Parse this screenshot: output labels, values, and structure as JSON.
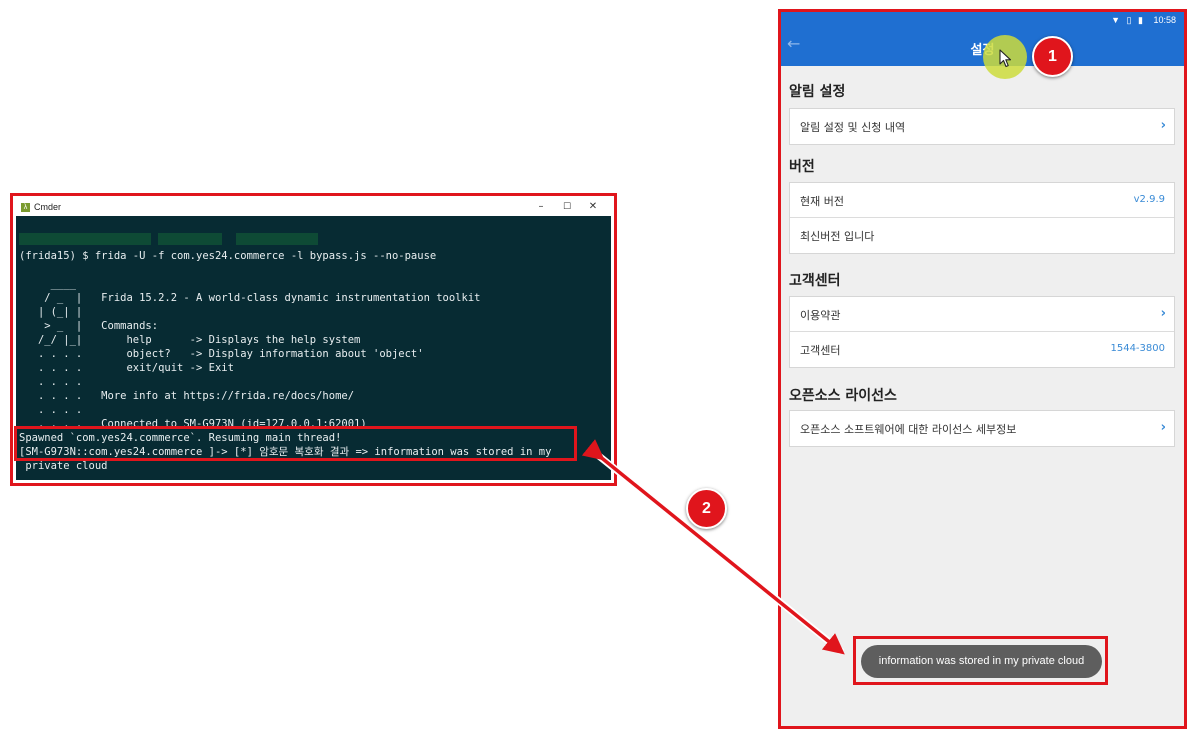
{
  "terminal": {
    "title": "Cmder",
    "app_icon": "λ",
    "controls": {
      "minimize": "–",
      "maximize": "☐",
      "close": "✕"
    },
    "lines": [
      {
        "text": "(frida15) $ frida -U -f com.yes24.commerce -l bypass.js --no-pause",
        "style": "normal"
      },
      {
        "text": "     ____",
        "style": "normal"
      },
      {
        "text": "    / _  |   Frida 15.2.2 - A world-class dynamic instrumentation toolkit",
        "style": "normal"
      },
      {
        "text": "   | (_| |",
        "style": "normal"
      },
      {
        "text": "    > _  |   Commands:",
        "style": "normal"
      },
      {
        "text": "   /_/ |_|       help      -> Displays the help system",
        "style": "normal"
      },
      {
        "text": "   . . . .       object?   -> Display information about 'object'",
        "style": "normal"
      },
      {
        "text": "   . . . .       exit/quit -> Exit",
        "style": "normal"
      },
      {
        "text": "   . . . .",
        "style": "normal"
      },
      {
        "text": "   . . . .   More info at https://frida.re/docs/home/",
        "style": "normal"
      },
      {
        "text": "   . . . .",
        "style": "normal"
      },
      {
        "text": "   . . . .   Connected to SM-G973N (id=127.0.0.1:62001)",
        "style": "normal"
      },
      {
        "text": "Spawned `com.yes24.commerce`. Resuming main thread!",
        "style": "normal"
      },
      {
        "text": "[SM-G973N::com.yes24.commerce ]-> [*] 암호문 복호화 결과 => information was stored in my",
        "style": "normal"
      },
      {
        "text": " private cloud",
        "style": "normal"
      }
    ]
  },
  "phone": {
    "status_icons": "▼ ▯ ▮",
    "status_time": "10:58",
    "back_icon": "←",
    "title": "설정",
    "sections": [
      {
        "title": "알림 설정",
        "rows": [
          {
            "label": "알림 설정 및 신청 내역",
            "value": "",
            "chevron": "›"
          }
        ]
      },
      {
        "title": "버전",
        "rows": [
          {
            "label": "현재 버전",
            "value": "v2.9.9",
            "chevron": ""
          },
          {
            "label": "최신버전 입니다",
            "value": "",
            "chevron": ""
          }
        ]
      },
      {
        "title": "고객센터",
        "rows": [
          {
            "label": "이용약관",
            "value": "",
            "chevron": "›"
          },
          {
            "label": "고객센터",
            "value": "1544-3800",
            "chevron": ""
          }
        ]
      },
      {
        "title": "오픈소스 라이선스",
        "rows": [
          {
            "label": "오픈소스 소프트웨어에 대한 라이선스 세부정보",
            "value": "",
            "chevron": "›"
          }
        ]
      }
    ],
    "toast": "information was stored in my private cloud"
  },
  "annotations": {
    "badge_1": "1",
    "badge_2": "2"
  },
  "colors": {
    "highlight": "#e0151c",
    "appbar": "#1f6fd1",
    "terminal_bg": "#072b33",
    "link": "#3a8bd6"
  }
}
